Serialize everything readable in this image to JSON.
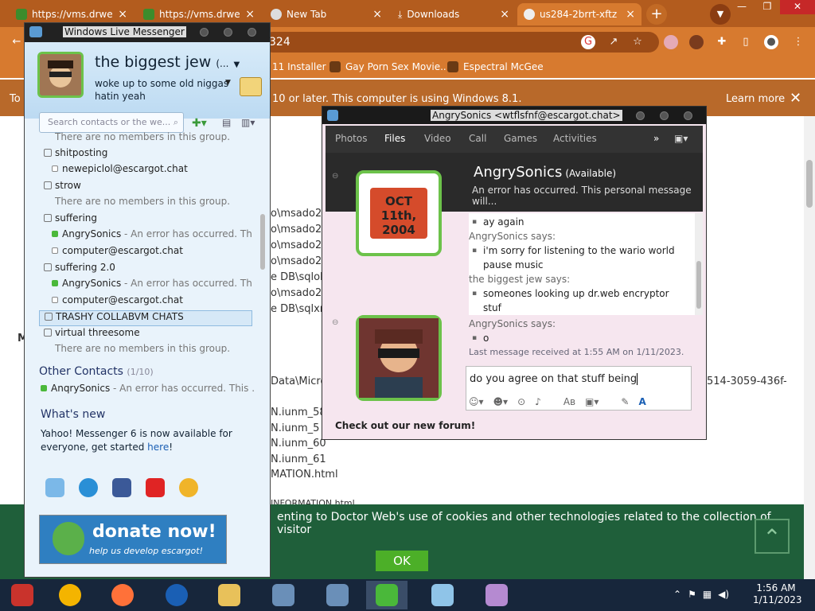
{
  "browser": {
    "tabs": [
      {
        "label": "https://vms.drwe"
      },
      {
        "label": "https://vms.drwe"
      },
      {
        "label": "New Tab"
      },
      {
        "label": "Downloads"
      },
      {
        "label": "us284-2brrt-xftz"
      }
    ],
    "address": "324",
    "bookmarks": [
      "11 Installer",
      "Gay Porn Sex Movie...",
      "Espectral McGee"
    ],
    "infobar": {
      "prefix": "To",
      "text": "10 or later. This computer is using Windows 8.1.",
      "learn_more": "Learn more"
    },
    "content_lines": [
      "o\\msado2",
      "o\\msado2",
      "o\\msado2",
      "o\\msado2",
      "e DB\\sqlol",
      "o\\msado2",
      "e DB\\sqlxm",
      "M",
      "Data\\Micro",
      "514-3059-436f-",
      "N.iunm_58",
      "N.iunm_5",
      "N.iunm_60",
      "N.iunm_61",
      "MATION.html",
      "INFORMATION.html"
    ],
    "cookie_text": "enting to Doctor Web's use of cookies and other technologies related to the collection of visitor",
    "ok_label": "OK"
  },
  "messenger": {
    "title": "Windows Live Messenger",
    "display_name": "the biggest jew",
    "display_name_suffix": "(...",
    "personal_message": "woke up to some old niggas hatin yeah",
    "search_placeholder": "Search contacts or the we...",
    "rows": [
      {
        "kind": "em",
        "text": "There are no members in this group."
      },
      {
        "kind": "grp",
        "text": "shitposting"
      },
      {
        "kind": "off",
        "text": "newepiclol@escargot.chat"
      },
      {
        "kind": "grp",
        "text": "strow"
      },
      {
        "kind": "em",
        "text": "There are no members in this group."
      },
      {
        "kind": "grp",
        "text": "suffering"
      },
      {
        "kind": "on",
        "text": "AngrySonics",
        "pm": " - An error has occurred. Thi..."
      },
      {
        "kind": "off",
        "text": "computer@escargot.chat"
      },
      {
        "kind": "grp",
        "text": "suffering 2.0"
      },
      {
        "kind": "on",
        "text": "AngrySonics",
        "pm": " - An error has occurred. Thi..."
      },
      {
        "kind": "off",
        "text": "computer@escargot.chat"
      },
      {
        "kind": "grp",
        "text": "TRASHY COLLABVM CHATS",
        "selected": true
      },
      {
        "kind": "grp",
        "text": "virtual threesome"
      },
      {
        "kind": "em",
        "text": "There are no members in this group."
      }
    ],
    "other_contacts": "Other Contacts",
    "other_count": "(1/10)",
    "other_row": {
      "name": "AnqrySonics",
      "pm": " - An error has occurred. This ..."
    },
    "whats_new_title": "What's new",
    "whats_new_text": "Yahoo! Messenger 6 is now available for everyone, get started ",
    "whats_new_link": "here",
    "whats_new_end": "!",
    "donate_big": "donate now!",
    "donate_small": "help us develop escargot!"
  },
  "chat": {
    "title": "AngrySonics <wtflsfnf@escargot.chat>",
    "tabs": [
      "Photos",
      "Files",
      "Video",
      "Call",
      "Games",
      "Activities"
    ],
    "contact_name": "AngrySonics",
    "contact_status": "(Available)",
    "contact_pm": "An error has occurred. This personal message will...",
    "pic_text": "OCT 11th, 2004",
    "conversation": [
      {
        "kind": "msg",
        "text": "ay again"
      },
      {
        "kind": "who",
        "text": "AngrySonics says:"
      },
      {
        "kind": "msg",
        "text": "i'm sorry for listening to the wario world"
      },
      {
        "kind": "msg2",
        "text": "pause music"
      },
      {
        "kind": "who",
        "text": "the biggest jew says:"
      },
      {
        "kind": "msg",
        "text": "someones looking up dr.web encryptor"
      },
      {
        "kind": "msg2",
        "text": "stuf"
      },
      {
        "kind": "who",
        "text": "AngrySonics says:"
      },
      {
        "kind": "msg",
        "text": "o"
      }
    ],
    "last_received": "Last message received at 1:55 AM on 1/11/2023.",
    "input_value": "do you agree on that stuff being ",
    "forum": "Check out our new forum!"
  },
  "taskbar": {
    "time": "1:56 AM",
    "date": "1/11/2023"
  }
}
